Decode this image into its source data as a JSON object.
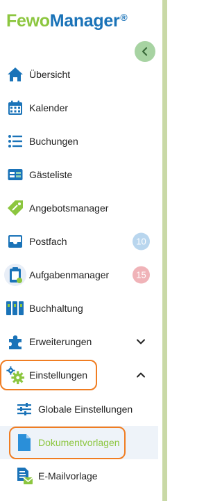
{
  "brand": {
    "part1": "Fewo",
    "part2": "Manager",
    "reg": "®"
  },
  "nav": {
    "uebersicht": "Übersicht",
    "kalender": "Kalender",
    "buchungen": "Buchungen",
    "gaesteliste": "Gästeliste",
    "angebotsmanager": "Angebotsmanager",
    "postfach": "Postfach",
    "postfach_badge": "10",
    "aufgabenmanager": "Aufgabenmanager",
    "aufgabenmanager_badge": "15",
    "buchhaltung": "Buchhaltung",
    "erweiterungen": "Erweiterungen",
    "einstellungen": "Einstellungen"
  },
  "sub": {
    "globale": "Globale Einstellungen",
    "dokumentvorlagen": "Dokumentvorlagen",
    "emailvorlage": "E-Mailvorlage"
  },
  "colors": {
    "brand_green": "#8cc63f",
    "brand_blue": "#1a73b8",
    "highlight_orange": "#f07d22",
    "postfach_badge": "#b9d6ee",
    "aufgaben_badge": "#f0b3b8"
  },
  "icons": {
    "uebersicht": "home-icon",
    "kalender": "calendar-icon",
    "buchungen": "list-icon",
    "gaesteliste": "id-card-icon",
    "angebotsmanager": "tag-icon",
    "postfach": "inbox-icon",
    "aufgabenmanager": "clipboard-icon",
    "buchhaltung": "binders-icon",
    "erweiterungen": "puzzle-icon",
    "einstellungen": "gears-icon",
    "globale": "sliders-icon",
    "dokumentvorlagen": "document-icon",
    "emailvorlage": "email-template-icon"
  }
}
